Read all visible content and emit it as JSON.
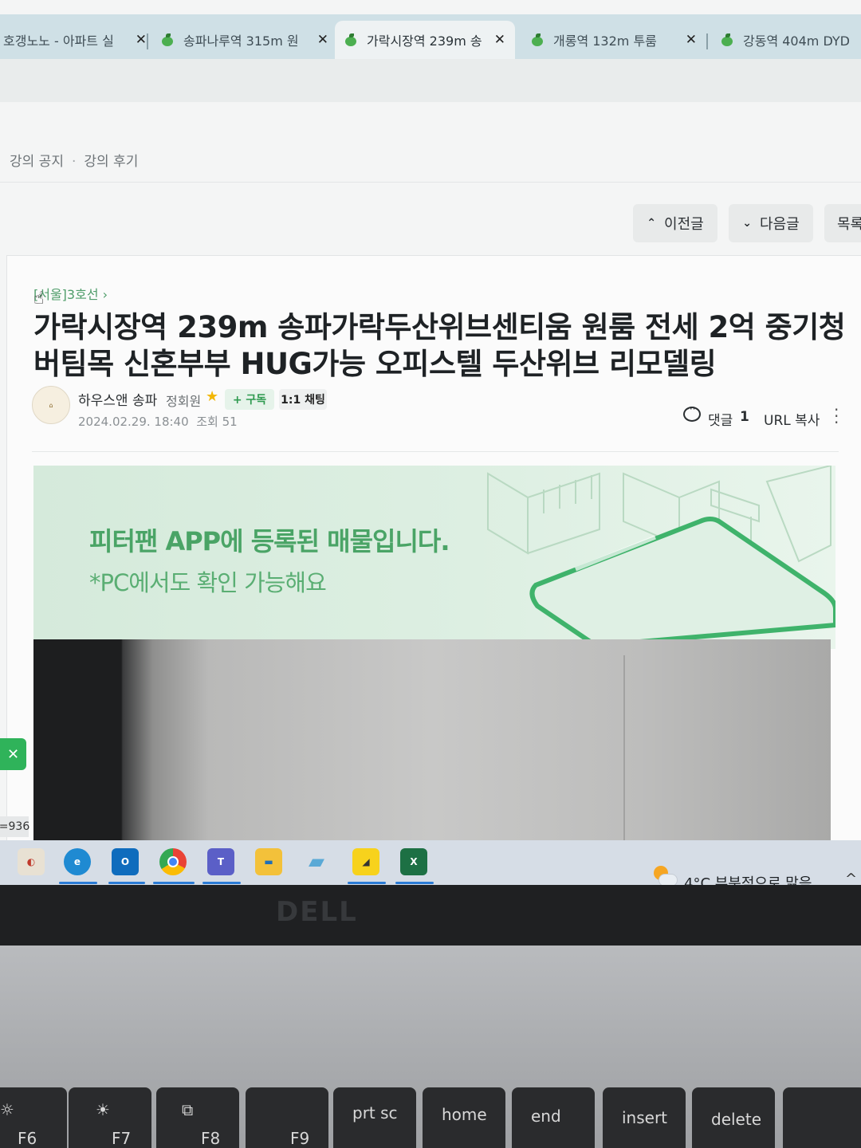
{
  "tabs": [
    {
      "label": "호갱노노 - 아파트 실",
      "active": false
    },
    {
      "label": "송파나루역 315m 원",
      "active": false
    },
    {
      "label": "가락시장역 239m 송",
      "active": true
    },
    {
      "label": "개롱역 132m 투룸",
      "active": false
    },
    {
      "label": "강동역 404m DYD",
      "active": false
    }
  ],
  "tab_close_glyph": "✕",
  "category_nav": [
    "강의 공지",
    "강의 후기"
  ],
  "nav_buttons": {
    "prev": "이전글",
    "next": "다음글",
    "list": "목록"
  },
  "post": {
    "breadcrumb": "[서울]3호선 ›",
    "title": "가락시장역 239m 송파가락두산위브센티움 원룸 전세 2억 중기청 버팀목 신혼부부 HUG가능 오피스텔 두산위브 리모델링",
    "author": "하우스앤 송파",
    "role": "정회원",
    "subscribe_label": "+ 구독",
    "chat_label": "1:1 채팅",
    "date": "2024.02.29. 18:40",
    "views": "조회 51",
    "comment_label": "댓글",
    "comment_count": "1",
    "url_copy": "URL 복사"
  },
  "banner": {
    "main": "피터팬 APP에 등록된 매물입니다.",
    "sub": "*PC에서도 확인 가능해요"
  },
  "floating": {
    "close": "✕",
    "counter": "=936"
  },
  "taskbar": {
    "apps": [
      "paint-icon",
      "edge-icon",
      "outlook-icon",
      "chrome-icon",
      "teams-icon",
      "file-explorer-icon",
      "tablet-icon",
      "sticky-notes-icon",
      "excel-icon"
    ],
    "weather": "4°C  부분적으로 맑음",
    "tray_chevron": "^"
  },
  "laptop": {
    "brand": "DELL",
    "keys": [
      {
        "label": "F6",
        "glyph": "☼"
      },
      {
        "label": "F7",
        "glyph": "☀"
      },
      {
        "label": "F8",
        "glyph": "⧉"
      },
      {
        "label": "F9",
        "glyph": ""
      },
      {
        "label": "prt sc",
        "glyph": ""
      },
      {
        "label": "home",
        "glyph": ""
      },
      {
        "label": "end",
        "glyph": ""
      },
      {
        "label": "insert",
        "glyph": ""
      },
      {
        "label": "delete",
        "glyph": ""
      },
      {
        "label": "",
        "glyph": ""
      }
    ]
  },
  "colors": {
    "brand_green": "#2fb35a",
    "banner_text": "#4aa466",
    "tab_bar": "#cfe0e6"
  }
}
